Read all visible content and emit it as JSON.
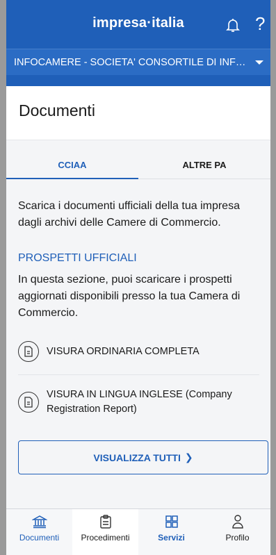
{
  "app": {
    "brand": "impresa·italia",
    "company": "INFOCAMERE - SOCIETA' CONSORTILE DI INFOR..."
  },
  "page": {
    "title": "Documenti"
  },
  "tabs": [
    {
      "label": "CCIAA",
      "active": true
    },
    {
      "label": "ALTRE PA",
      "active": false
    }
  ],
  "intro": "Scarica i documenti ufficiali della tua impresa dagli archivi delle Camere di Commercio.",
  "section": {
    "title": "PROSPETTI UFFICIALI",
    "description": "In questa sezione, puoi scaricare i prospetti aggiornati disponibili presso la tua Camera di Commercio."
  },
  "documents": [
    {
      "label": "VISURA ORDINARIA COMPLETA",
      "icon": "document-icon"
    },
    {
      "label": "VISURA IN LINGUA INGLESE (Company Registration Report)",
      "icon": "document-icon"
    }
  ],
  "view_all": {
    "label": "VISUALIZZA TUTTI",
    "icon": "chevron-right-icon"
  },
  "bottom_nav": [
    {
      "label": "Documenti",
      "icon": "institution-icon",
      "active": true
    },
    {
      "label": "Procedimenti",
      "icon": "clipboard-icon",
      "active": false
    },
    {
      "label": "Servizi",
      "icon": "grid-icon",
      "active": false
    },
    {
      "label": "Profilo",
      "icon": "user-icon",
      "active": false
    }
  ],
  "colors": {
    "primary": "#1f5fb8",
    "background": "#f4f5f7"
  }
}
